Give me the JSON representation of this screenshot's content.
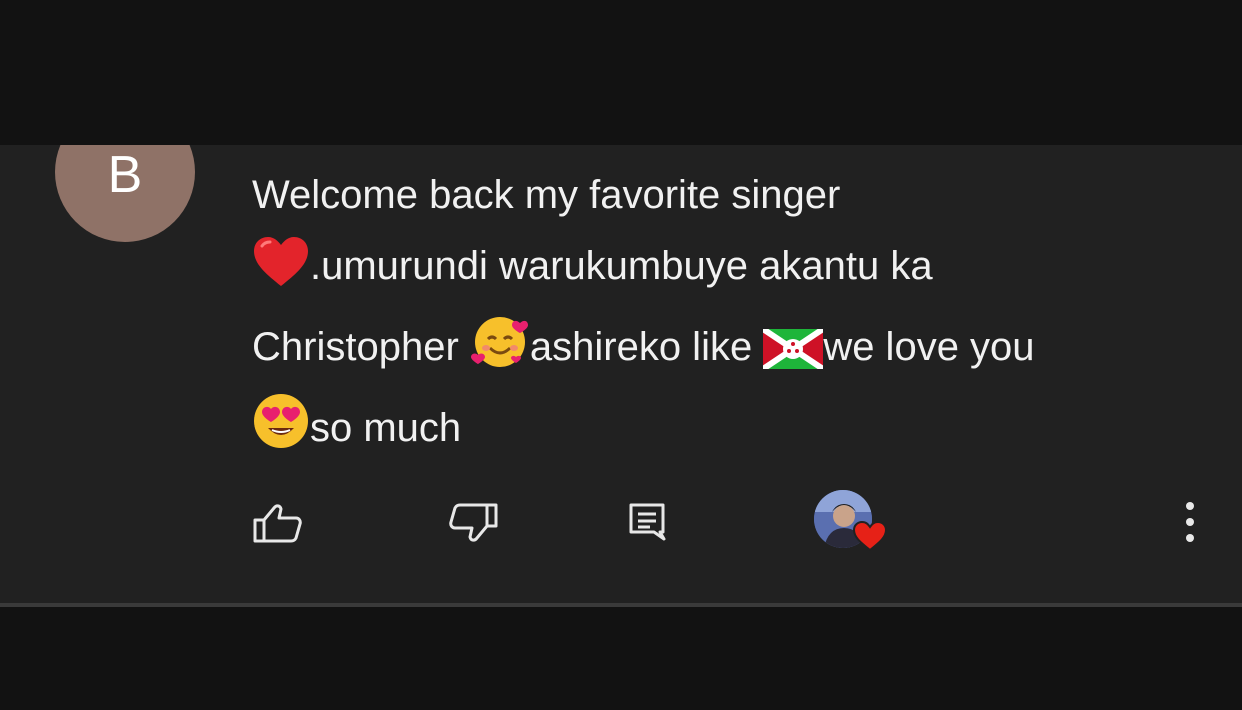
{
  "comment": {
    "author_initial": "B",
    "lines": [
      {
        "text_before": "Welcome back my favorite singer",
        "text_after": ""
      },
      {
        "text_before": "",
        "emoji": "red-heart",
        "text_after": ".umurundi warukumbuye akantu ka"
      },
      {
        "text_before": "Christopher ",
        "emoji": "smiling-face-with-hearts",
        "text_mid": "ashireko like ",
        "emoji2": "burundi-flag",
        "text_after": "we love you"
      },
      {
        "text_before": "",
        "emoji": "heart-eyes",
        "text_after": "so much"
      }
    ]
  },
  "actions": {
    "like_icon": "thumbs-up-icon",
    "dislike_icon": "thumbs-down-icon",
    "reply_icon": "reply-comment-icon",
    "creator_heart_icon": "creator-heart-icon",
    "more_icon": "more-vertical-icon"
  },
  "colors": {
    "background": "#121212",
    "card": "#212121",
    "avatar": "#8f7267",
    "text": "#f1f1f1",
    "heart": "#e62117"
  }
}
